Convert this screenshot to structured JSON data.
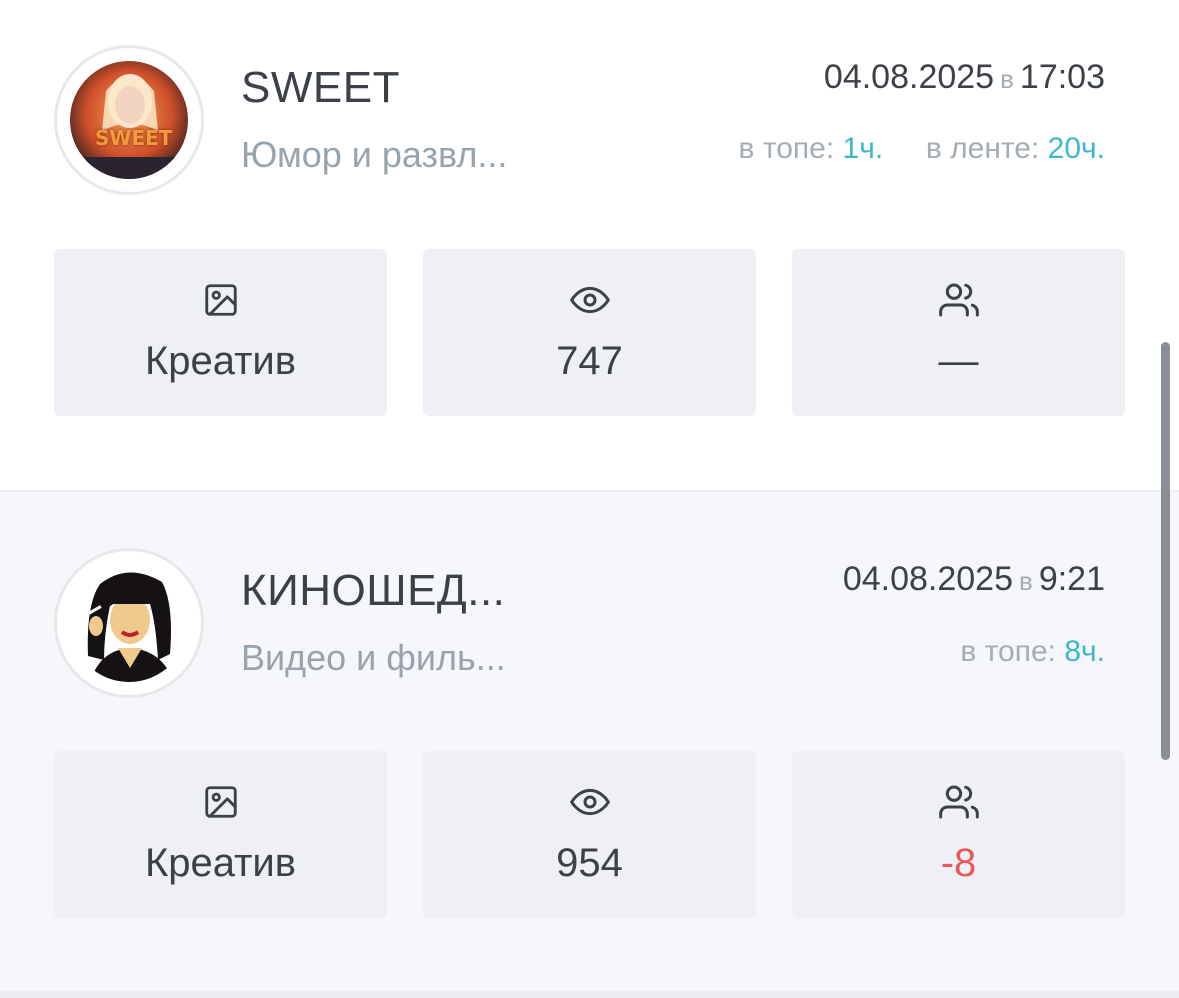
{
  "posts": [
    {
      "channel_name": "SWEET",
      "category": "Юмор и развл...",
      "date": "04.08.2025",
      "at_word": "в",
      "time": "17:03",
      "top_label": "в топе:",
      "top_value": "1ч.",
      "feed_label": "в ленте:",
      "feed_value": "20ч.",
      "avatar_text": "SWEET",
      "tiles": [
        {
          "icon": "image-icon",
          "label": "Креатив"
        },
        {
          "icon": "eye-icon",
          "label": "747"
        },
        {
          "icon": "users-icon",
          "label": "—"
        }
      ]
    },
    {
      "channel_name": "КИНОШЕД...",
      "category": "Видео и филь...",
      "date": "04.08.2025",
      "at_word": "в",
      "time": "9:21",
      "top_label": "в топе:",
      "top_value": "8ч.",
      "tiles": [
        {
          "icon": "image-icon",
          "label": "Креатив"
        },
        {
          "icon": "eye-icon",
          "label": "954"
        },
        {
          "icon": "users-icon",
          "label": "-8",
          "color": "#e8585b"
        }
      ]
    }
  ],
  "colors": {
    "accent": "#3fb6cf",
    "negative": "#e8585b",
    "tile_bg": "#eef0f5"
  }
}
